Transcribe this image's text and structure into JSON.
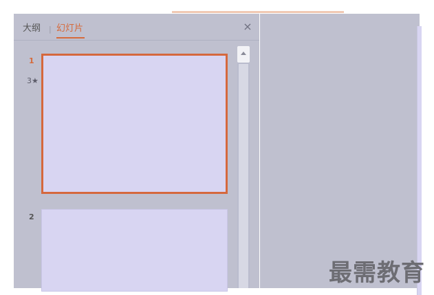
{
  "tabs": {
    "outline_label": "大纲",
    "separator": "|",
    "slides_label": "幻灯片"
  },
  "slides": [
    {
      "number": "1",
      "animation_marker": "⁠⁠⁠⁠⁠⁠⁠⁠⁠⁠⁠⁠3★",
      "selected": true
    },
    {
      "number": "2",
      "selected": false
    }
  ],
  "watermark": "最需教育",
  "colors": {
    "accent": "#d5683d",
    "panel": "#bfc0cf",
    "slide": "#d8d5f2"
  },
  "icons": {
    "close": "close-icon",
    "scroll_up": "scroll-up-arrow-icon"
  }
}
